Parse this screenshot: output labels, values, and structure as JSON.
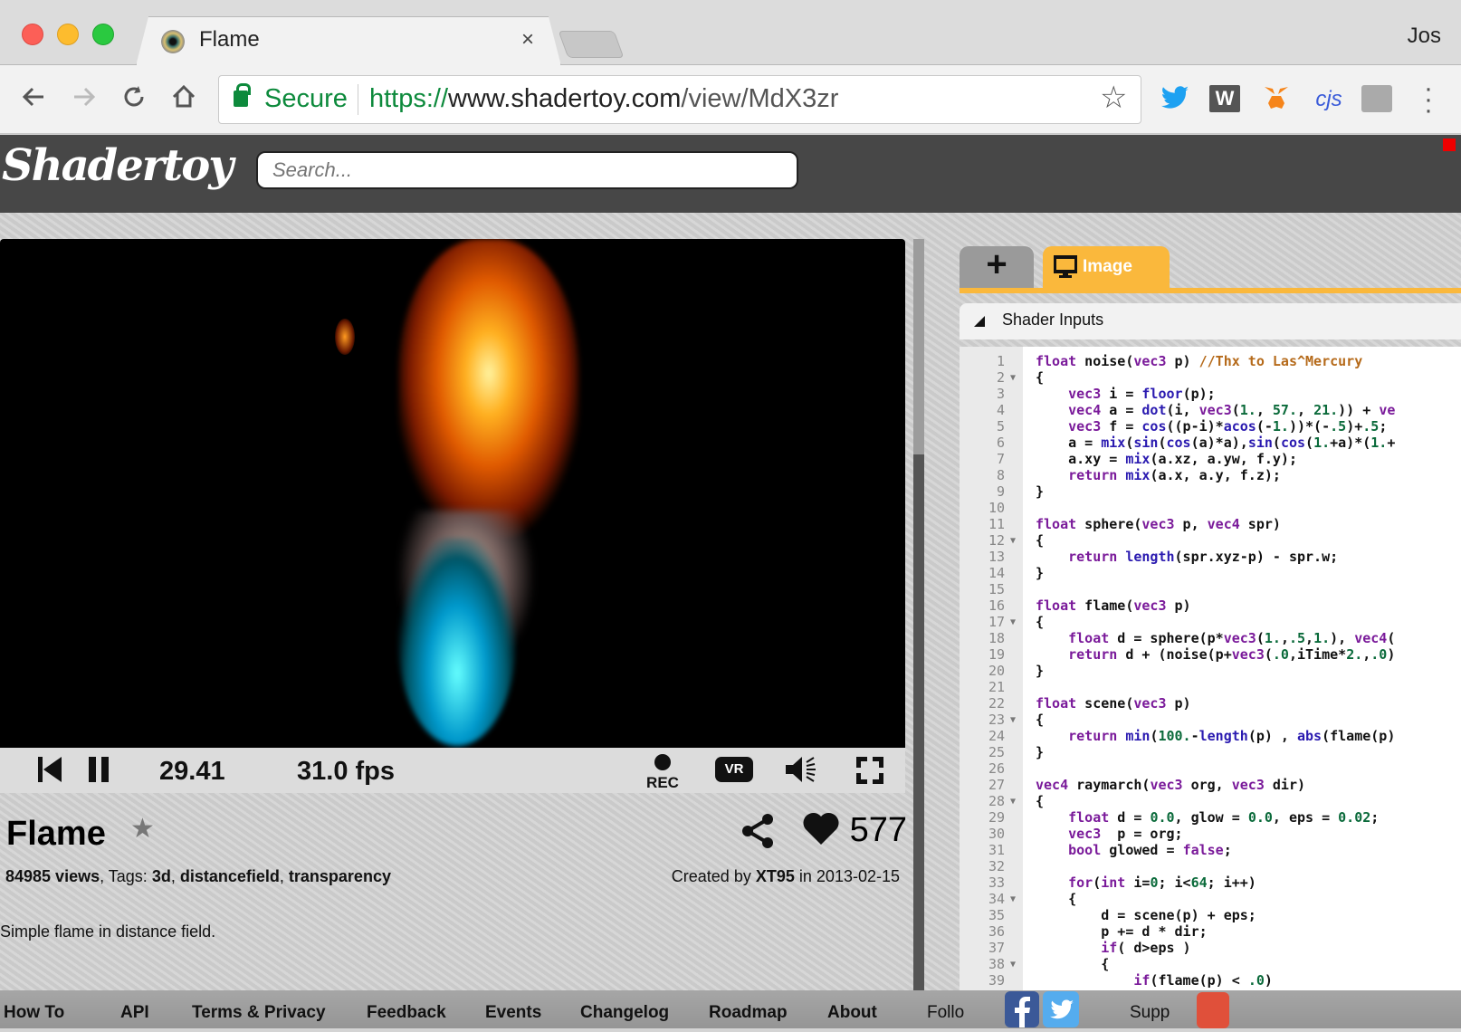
{
  "browser": {
    "tab_title": "Flame",
    "tab_close": "×",
    "profile": "Jos",
    "secure_label": "Secure",
    "url_scheme": "https://",
    "url_host": "www.shadertoy.com",
    "url_path": "/view/MdX3zr",
    "extensions": [
      "twitter-icon",
      "w-icon",
      "metamask-icon",
      "cjs-icon",
      "image-icon"
    ],
    "ext_w": "W",
    "ext_cjs": "cjs"
  },
  "site": {
    "logo": "Shadertoy",
    "search_placeholder": "Search..."
  },
  "player": {
    "time": "29.41",
    "fps": "31.0 fps",
    "rec_label": "REC",
    "vr_label": "VR"
  },
  "shader": {
    "title": "Flame",
    "likes": "577",
    "views": "84985 views",
    "tags_label": "Tags:",
    "tags": [
      "3d",
      "distancefield",
      "transparency"
    ],
    "created_prefix": "Created by",
    "author": "XT95",
    "created_in": "in 2013-02-15",
    "description": "Simple flame in distance field."
  },
  "editor": {
    "tab_add": "+",
    "tab_image": "Image",
    "shader_inputs": "Shader Inputs"
  },
  "footer": {
    "links": [
      "How To",
      "API",
      "Terms & Privacy",
      "Feedback",
      "Events",
      "Changelog",
      "Roadmap",
      "About"
    ],
    "follow": "Follo",
    "support": "Supp"
  },
  "accent_colors": {
    "orange": "#fab83c",
    "header": "#474747",
    "secure_green": "#0d8a3c"
  }
}
